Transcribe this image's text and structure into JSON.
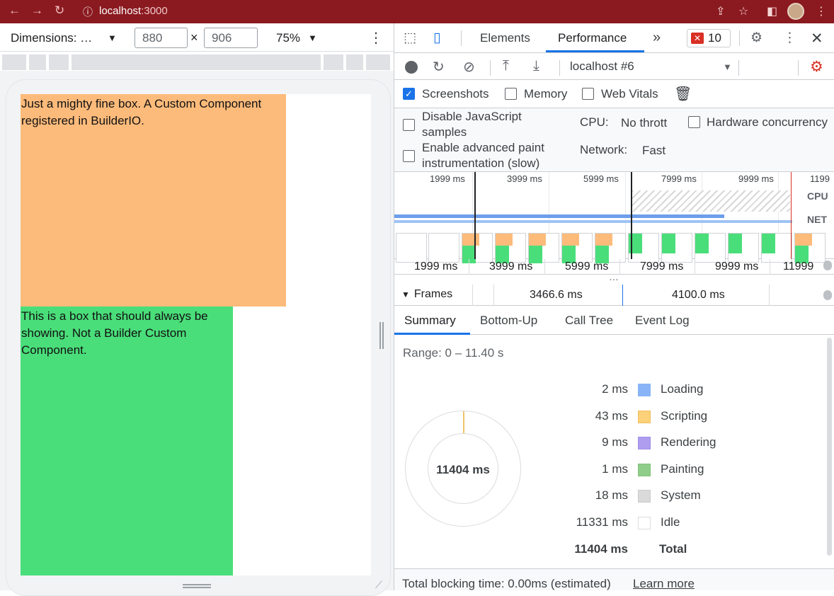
{
  "browser": {
    "url_host": "localhost",
    "url_port": ":3000"
  },
  "device_toolbar": {
    "dimensions_label": "Dimensions: …",
    "width_value": "880",
    "height_value": "906",
    "times": "×",
    "zoom": "75%"
  },
  "viewport": {
    "box1_text": "Just a mighty fine box. A Custom Component registered in BuilderIO.",
    "box2_text": "This is a box that should always be showing. Not a Builder Custom Component.",
    "colors": {
      "box1": "#fdbb7b",
      "box2": "#4ade7a"
    }
  },
  "devtools": {
    "tabs": [
      "Elements",
      "Performance"
    ],
    "more_tabs": "»",
    "error_count": "10",
    "session": "localhost #6",
    "options": {
      "screenshots": "Screenshots",
      "memory": "Memory",
      "web_vitals": "Web Vitals"
    },
    "settings": {
      "disable_js_line1": "Disable JavaScript",
      "disable_js_line2": "samples",
      "adv_paint_line1": "Enable advanced paint",
      "adv_paint_line2": "instrumentation (slow)",
      "cpu_label": "CPU:",
      "cpu_value": "No thrott",
      "hw_concurrency": "Hardware concurrency",
      "network_label": "Network:",
      "network_value": "Fast"
    },
    "overview_ticks": [
      "1999 ms",
      "3999 ms",
      "5999 ms",
      "7999 ms",
      "9999 ms",
      "1199"
    ],
    "overview_labels": {
      "cpu": "CPU",
      "net": "NET"
    },
    "ruler_ticks": [
      "1999 ms",
      "3999 ms",
      "5999 ms",
      "7999 ms",
      "9999 ms",
      "11999"
    ],
    "ruler_more": "…",
    "frames": {
      "title": "Frames",
      "values": [
        "3466.6 ms",
        "4100.0 ms"
      ]
    },
    "summary_tabs": [
      "Summary",
      "Bottom-Up",
      "Call Tree",
      "Event Log"
    ],
    "summary": {
      "range": "Range: 0 – 11.40 s",
      "donut_total": "11404 ms",
      "rows": [
        {
          "ms": "2 ms",
          "name": "Loading",
          "color": "#8ab4f8"
        },
        {
          "ms": "43 ms",
          "name": "Scripting",
          "color": "#fdd07a"
        },
        {
          "ms": "9 ms",
          "name": "Rendering",
          "color": "#af9ef0"
        },
        {
          "ms": "1 ms",
          "name": "Painting",
          "color": "#8fce8a"
        },
        {
          "ms": "18 ms",
          "name": "System",
          "color": "#dadada"
        },
        {
          "ms": "11331 ms",
          "name": "Idle",
          "color": "#ffffff"
        }
      ],
      "total_ms": "11404 ms",
      "total_label": "Total"
    },
    "footer": {
      "blocking": "Total blocking time: 0.00ms (estimated)",
      "learn_more": "Learn more"
    }
  }
}
